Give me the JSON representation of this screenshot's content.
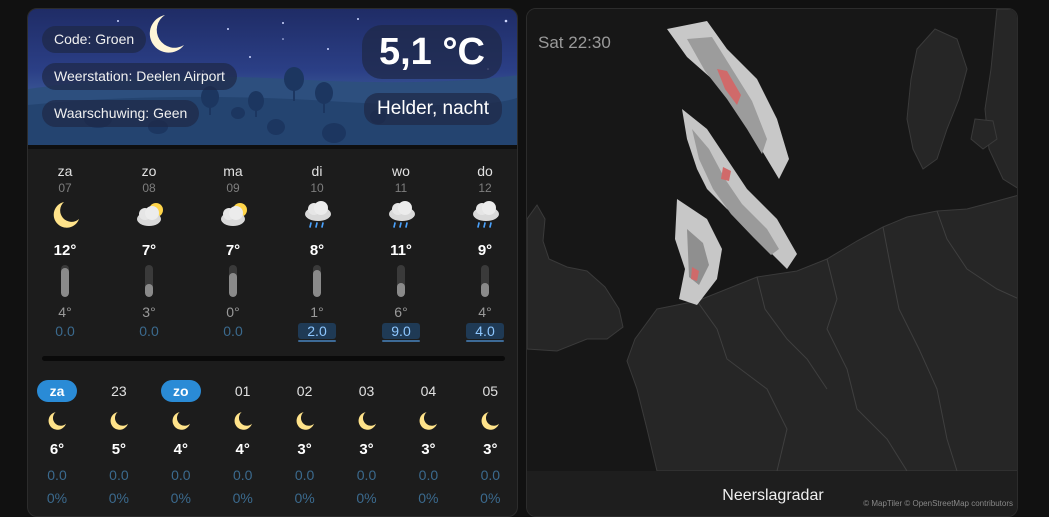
{
  "weather": {
    "code_label": "Code: Groen",
    "station_label": "Weerstation: Deelen Airport",
    "warning_label": "Waarschuwing: Geen",
    "temperature": "5,1 °C",
    "condition": "Helder, nacht",
    "daily": [
      {
        "day": "za",
        "date": "07",
        "icon": "moon-icon",
        "high": "12°",
        "low": "4°",
        "precip": "0.0",
        "precip_active": false,
        "bar_fraction": 0.9
      },
      {
        "day": "zo",
        "date": "08",
        "icon": "partly-cloudy-icon",
        "high": "7°",
        "low": "3°",
        "precip": "0.0",
        "precip_active": false,
        "bar_fraction": 0.4
      },
      {
        "day": "ma",
        "date": "09",
        "icon": "partly-cloudy-icon",
        "high": "7°",
        "low": "0°",
        "precip": "0.0",
        "precip_active": false,
        "bar_fraction": 0.75
      },
      {
        "day": "di",
        "date": "10",
        "icon": "rain-icon",
        "high": "8°",
        "low": "1°",
        "precip": "2.0",
        "precip_active": true,
        "bar_fraction": 0.85
      },
      {
        "day": "wo",
        "date": "11",
        "icon": "rain-icon",
        "high": "11°",
        "low": "6°",
        "precip": "9.0",
        "precip_active": true,
        "bar_fraction": 0.45
      },
      {
        "day": "do",
        "date": "12",
        "icon": "rain-icon",
        "high": "9°",
        "low": "4°",
        "precip": "4.0",
        "precip_active": true,
        "bar_fraction": 0.45
      }
    ],
    "hourly": [
      {
        "label": "za",
        "badge": true,
        "temp": "6°",
        "precip": "0.0",
        "prob": "0%"
      },
      {
        "label": "23",
        "badge": false,
        "temp": "5°",
        "precip": "0.0",
        "prob": "0%"
      },
      {
        "label": "zo",
        "badge": true,
        "temp": "4°",
        "precip": "0.0",
        "prob": "0%"
      },
      {
        "label": "01",
        "badge": false,
        "temp": "4°",
        "precip": "0.0",
        "prob": "0%"
      },
      {
        "label": "02",
        "badge": false,
        "temp": "3°",
        "precip": "0.0",
        "prob": "0%"
      },
      {
        "label": "03",
        "badge": false,
        "temp": "3°",
        "precip": "0.0",
        "prob": "0%"
      },
      {
        "label": "04",
        "badge": false,
        "temp": "3°",
        "precip": "0.0",
        "prob": "0%"
      },
      {
        "label": "05",
        "badge": false,
        "temp": "3°",
        "precip": "0.0",
        "prob": "0%"
      }
    ]
  },
  "radar": {
    "time": "Sat 22:30",
    "title": "Neerslagradar",
    "attribution": "© MapTiler © OpenStreetMap contributors"
  },
  "colors": {
    "moon": "#ffe38a",
    "sun": "#ffd54a",
    "badge": "#2a8bd6",
    "precip_active": "#8ec7ff",
    "rain_drop": "#4aa3ff"
  }
}
